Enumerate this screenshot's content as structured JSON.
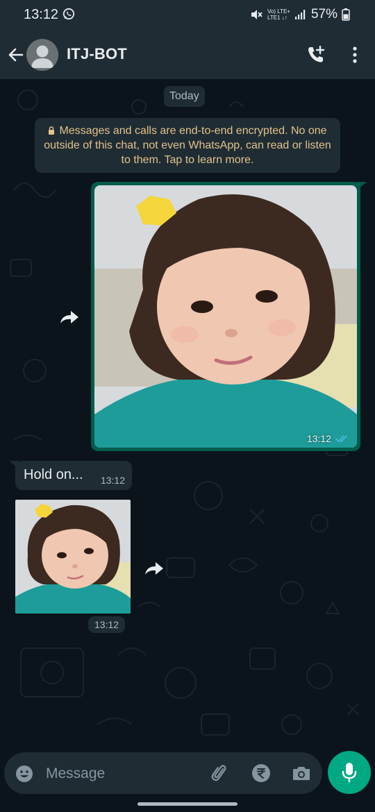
{
  "status_bar": {
    "time": "13:12",
    "volte_top": "Vo) LTE+",
    "volte_bottom": "LTE1 ↓↑",
    "battery": "57%"
  },
  "header": {
    "contact_name": "ITJ-BOT",
    "icons": [
      "back-arrow-icon",
      "avatar",
      "add-call-icon",
      "more-options-icon"
    ]
  },
  "chat": {
    "day_label": "Today",
    "encryption_notice": "Messages and calls are end-to-end encrypted. No one outside of this chat, not even WhatsApp, can read or listen to them. Tap to learn more.",
    "messages": [
      {
        "type": "image",
        "direction": "outgoing",
        "time": "13:12",
        "status": "read"
      },
      {
        "type": "text",
        "direction": "incoming",
        "text": "Hold on...",
        "time": "13:12"
      },
      {
        "type": "image",
        "direction": "incoming",
        "time": "13:12"
      }
    ]
  },
  "composer": {
    "placeholder": "Message"
  },
  "colors": {
    "background": "#0b141a",
    "bar": "#1f2c34",
    "outgoing_bubble": "#005c4b",
    "accent": "#00a884",
    "notice_text": "#e4c38b"
  }
}
